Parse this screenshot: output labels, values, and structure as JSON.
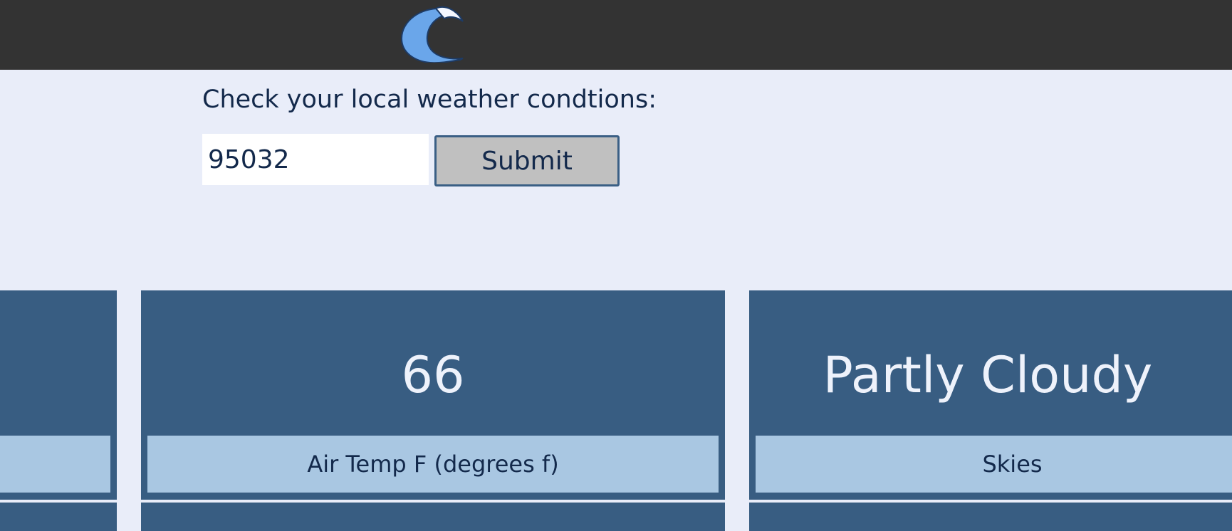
{
  "header": {
    "logo_icon": "wave-icon"
  },
  "form": {
    "prompt": "Check your local weather condtions:",
    "zip_value": "95032",
    "submit_label": "Submit"
  },
  "cards": [
    {
      "value": "",
      "label": ""
    },
    {
      "value": "66",
      "label": "Air Temp F (degrees f)"
    },
    {
      "value": "Partly Cloudy",
      "label": "Skies"
    }
  ],
  "colors": {
    "header_bg": "#333333",
    "page_bg": "#e9edf9",
    "card_bg": "#385d82",
    "label_bg": "#a9c7e2",
    "text": "#13294b",
    "button_bg": "#c0c0c0"
  }
}
